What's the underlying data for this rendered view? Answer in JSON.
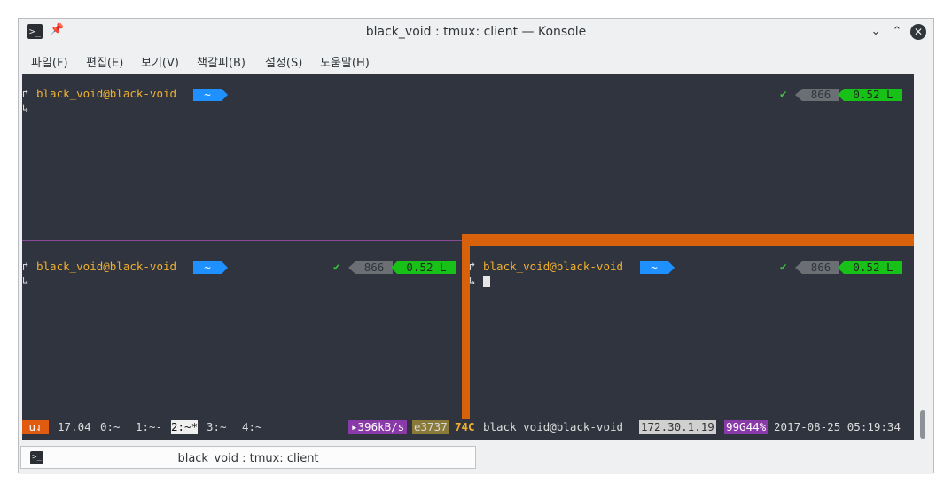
{
  "window": {
    "title": "black_void : tmux: client — Konsole"
  },
  "menu": [
    "파일(F)",
    "편집(E)",
    "보기(V)",
    "책갈피(B)",
    "설정(S)",
    "도움말(H)"
  ],
  "prompt": {
    "arrow_top": "↱",
    "arrow_bottom": "↳",
    "user_host": "black_void@black-void",
    "dir": "~",
    "check": "✔",
    "history": "866",
    "load": "0.52 L"
  },
  "status": {
    "host_badge": "u⇃",
    "version": "17.04",
    "windows": [
      "0:~",
      "1:~-",
      "2:~*",
      "3:~",
      "4:~"
    ],
    "active_window": 2,
    "net": "▸396kB/s",
    "id": "e3737",
    "temp": "74C",
    "user_host": "black_void@black-void",
    "ip": "172.30.1.19",
    "mem": "99G44%",
    "datetime": "2017-08-25 05:19:34"
  },
  "tab": {
    "label": "black_void : tmux: client"
  }
}
